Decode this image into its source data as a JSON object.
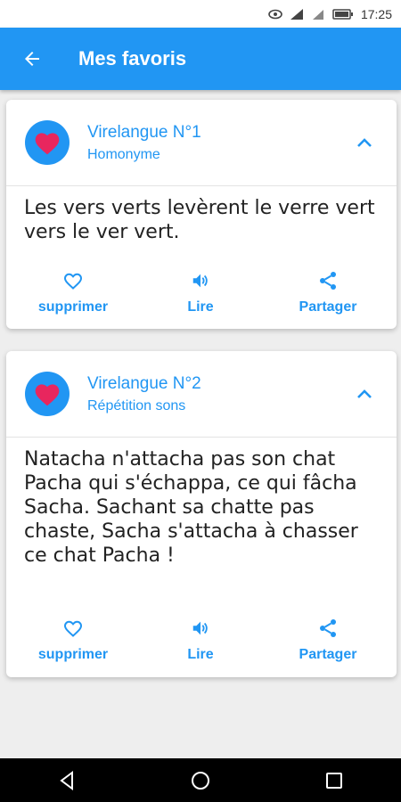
{
  "status_bar": {
    "time": "17:25"
  },
  "app_bar": {
    "title": "Mes favoris"
  },
  "cards": [
    {
      "title": "Virelangue N°1",
      "subtitle": "Homonyme",
      "text": "Les vers verts levèrent le verre vert vers le ver vert.",
      "actions": {
        "delete": "supprimer",
        "read": "Lire",
        "share": "Partager"
      }
    },
    {
      "title": "Virelangue N°2",
      "subtitle": "Répétition sons",
      "text": "Natacha n'attacha pas son chat Pacha qui s'échappa, ce qui fâcha Sacha. Sachant sa chatte pas chaste, Sacha s'attacha à chasser ce chat Pacha !",
      "actions": {
        "delete": "supprimer",
        "read": "Lire",
        "share": "Partager"
      }
    }
  ],
  "colors": {
    "primary": "#2196f3",
    "heart": "#e8265e"
  },
  "icons": [
    "back-arrow-icon",
    "heart-icon",
    "chevron-up-icon",
    "heart-outline-icon",
    "speaker-icon",
    "share-icon"
  ]
}
